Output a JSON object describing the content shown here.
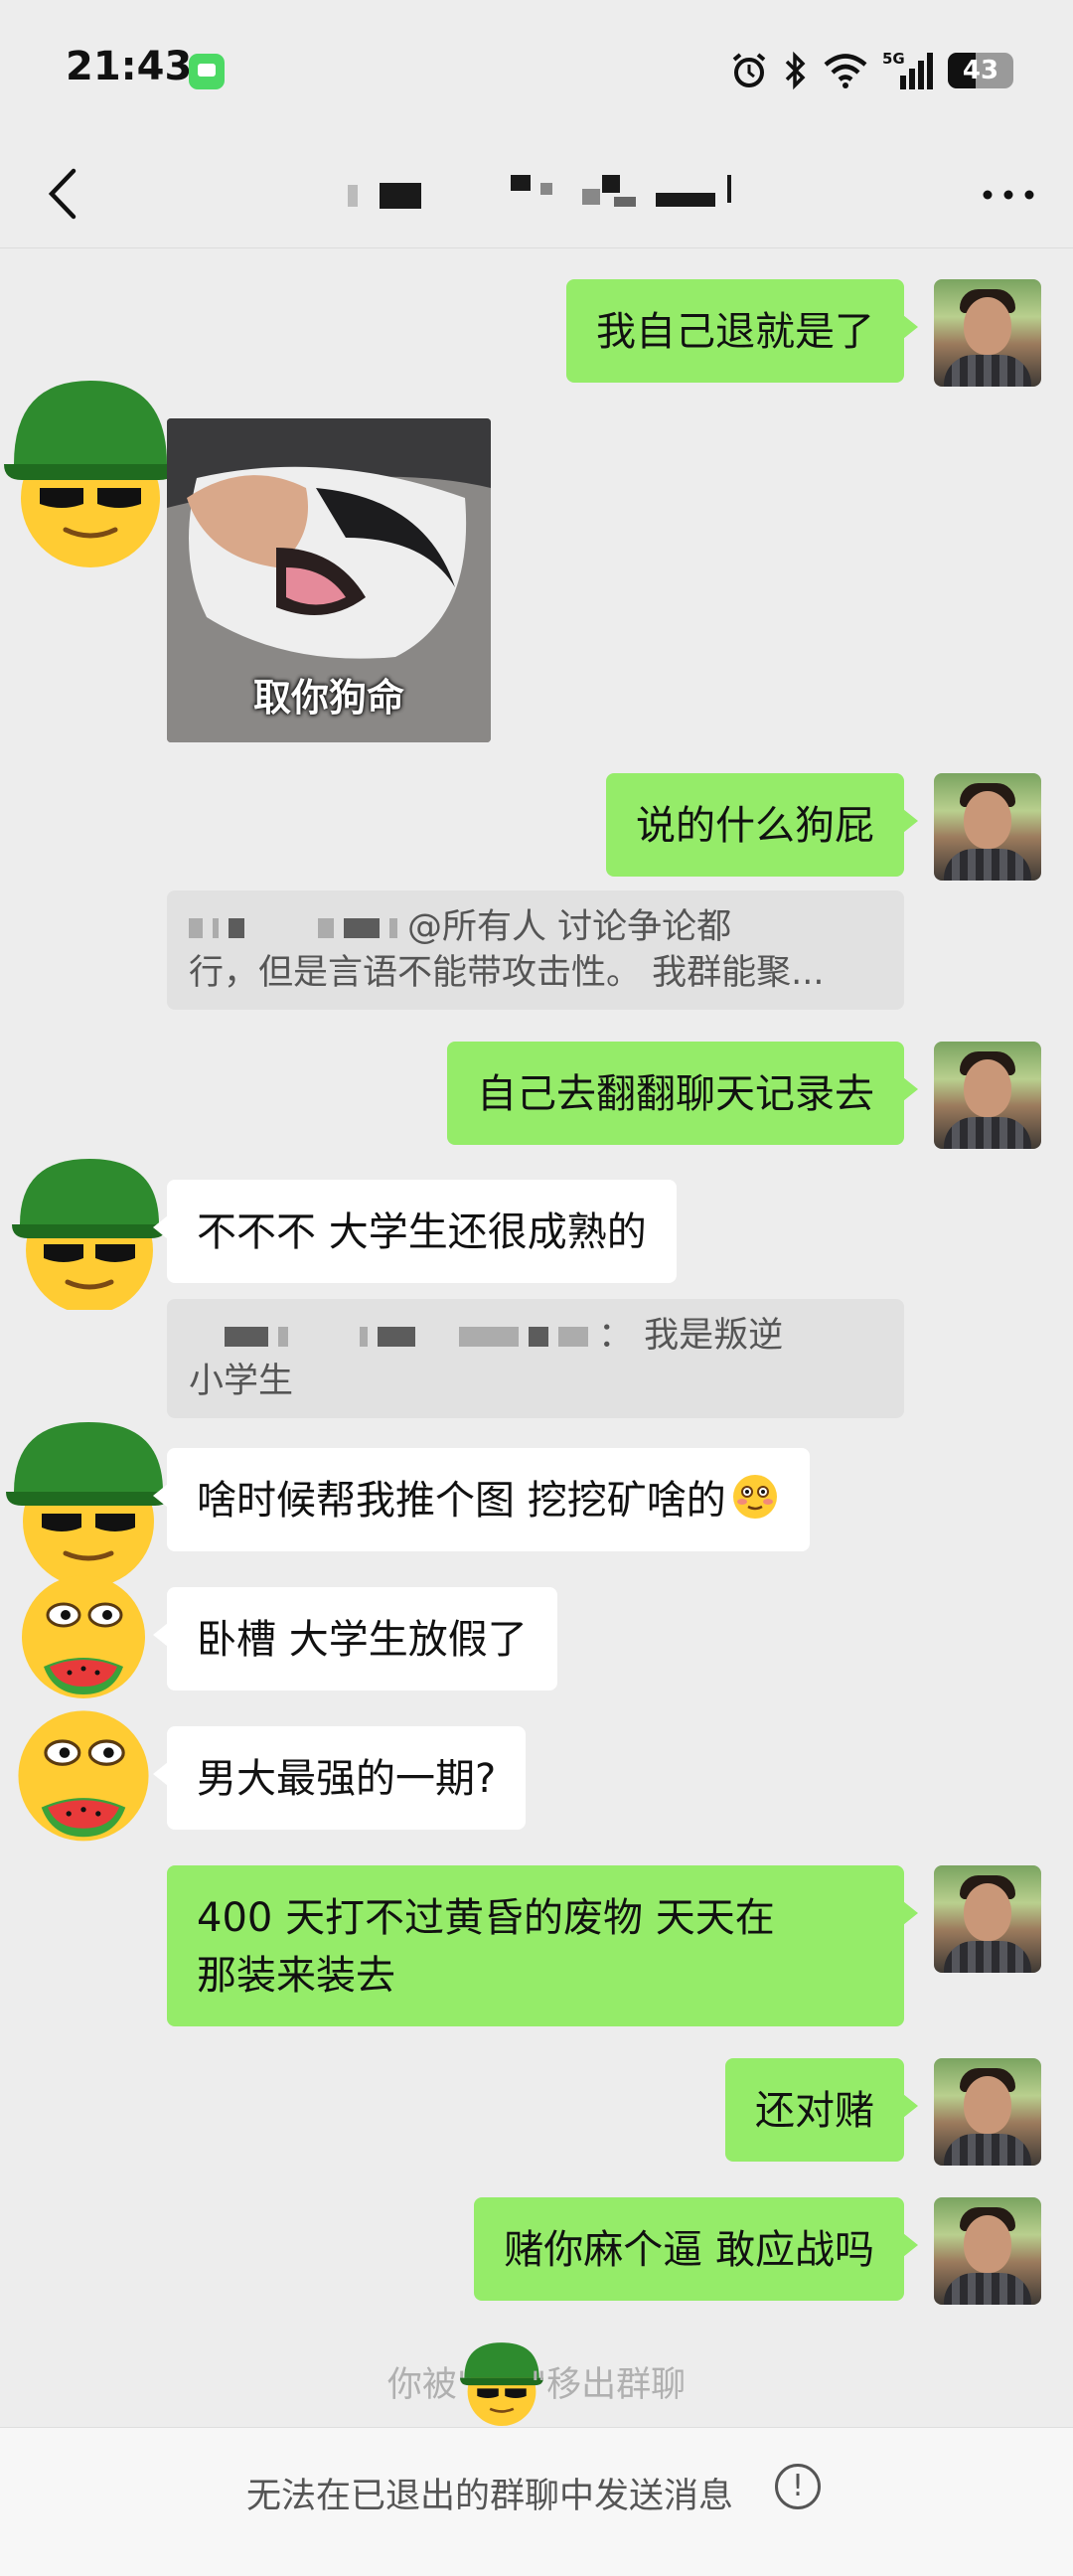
{
  "status_bar": {
    "time": "21:43",
    "network": "5G",
    "battery_level": "43",
    "battery_fraction": 0.43
  },
  "nav": {
    "back_icon": "chevron-left-icon",
    "title": "",
    "more_icon": "more-dots-icon"
  },
  "messages": [
    {
      "sender": "self",
      "type": "text",
      "text": "我自己退就是了"
    },
    {
      "sender": "other",
      "type": "sticker",
      "caption": "取你狗命"
    },
    {
      "sender": "self",
      "type": "text",
      "text": "说的什么狗屁"
    },
    {
      "sender": "system",
      "type": "quote",
      "line1": "@所有人 讨论争论都",
      "line2": "行，但是言语不能带攻击性。 我群能聚..."
    },
    {
      "sender": "self",
      "type": "text",
      "text": "自己去翻翻聊天记录去"
    },
    {
      "sender": "other",
      "type": "text",
      "text": "不不不 大学生还很成熟的"
    },
    {
      "sender": "system",
      "type": "quote",
      "line1": "： 我是叛逆",
      "line2": "小学生"
    },
    {
      "sender": "other",
      "type": "text",
      "text": "啥时候帮我推个图 挖挖矿啥的"
    },
    {
      "sender": "other",
      "type": "text",
      "text": "卧槽 大学生放假了"
    },
    {
      "sender": "other",
      "type": "text",
      "text": "男大最强的一期?"
    },
    {
      "sender": "self",
      "type": "text",
      "line1": "400 天打不过黄昏的废物 天天在",
      "line2": "那装来装去"
    },
    {
      "sender": "self",
      "type": "text",
      "text": "还对赌"
    },
    {
      "sender": "self",
      "type": "text",
      "text": "赌你麻个逼 敢应战吗"
    }
  ],
  "system_notice": {
    "prefix": "你被\"",
    "suffix": "\"移出群聊"
  },
  "bottom_bar": {
    "text": "无法在已退出的群聊中发送消息",
    "info_icon": "!"
  },
  "colors": {
    "self_bubble": "#95ec69",
    "other_bubble": "#ffffff",
    "background": "#ededed",
    "helmet": "#2e8b2e",
    "emoji_face": "#ffcc33"
  }
}
